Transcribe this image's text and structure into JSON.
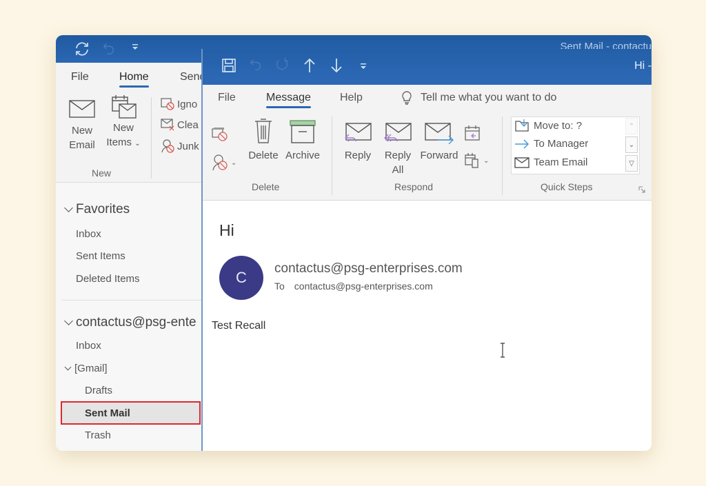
{
  "main_window": {
    "title": "Sent Mail - contactu",
    "quick_access": [
      {
        "icon": "sync-icon"
      },
      {
        "icon": "undo-icon"
      },
      {
        "icon": "customize-qat-icon"
      }
    ],
    "tabs": [
      {
        "label": "File",
        "active": false
      },
      {
        "label": "Home",
        "active": true
      },
      {
        "label": "Send",
        "active": false
      }
    ],
    "ribbon": {
      "new_group": {
        "label": "New",
        "new_email": "New\nEmail",
        "new_email_l1": "New",
        "new_email_l2": "Email",
        "new_items_l1": "New",
        "new_items_l2": "Items"
      },
      "delete_group_partial": [
        "Ignore",
        "Clean Up",
        "Junk"
      ],
      "delete_group_visible": [
        "Igno",
        "Clea",
        "Junk"
      ]
    },
    "nav": {
      "favorites_label": "Favorites",
      "favorites": [
        "Inbox",
        "Sent Items",
        "Deleted Items"
      ],
      "account_label": "contactus@psg-ente",
      "account_items": {
        "inbox": "Inbox",
        "gmail_label": "[Gmail]",
        "gmail_children": [
          "Drafts",
          "Sent Mail",
          "Trash"
        ]
      },
      "selected": "Sent Mail",
      "selection_highlight_color": "#e0262b"
    }
  },
  "message_window": {
    "title": "Hi  -",
    "quick_access": [
      {
        "icon": "save-icon"
      },
      {
        "icon": "undo-icon"
      },
      {
        "icon": "redo-icon"
      },
      {
        "icon": "previous-item-icon"
      },
      {
        "icon": "next-item-icon"
      },
      {
        "icon": "customize-qat-icon"
      }
    ],
    "tabs": [
      {
        "label": "File",
        "active": false
      },
      {
        "label": "Message",
        "active": true
      },
      {
        "label": "Help",
        "active": false
      }
    ],
    "tell_me_placeholder": "Tell me what you want to do",
    "ribbon": {
      "delete_group": {
        "label": "Delete",
        "delete": "Delete",
        "archive": "Archive"
      },
      "respond_group": {
        "label": "Respond",
        "reply": "Reply",
        "reply_all_l1": "Reply",
        "reply_all_l2": "All",
        "forward": "Forward"
      },
      "quick_steps_group": {
        "label": "Quick Steps",
        "items": [
          "Move to: ?",
          "To Manager",
          "Team Email"
        ]
      }
    },
    "reading_pane": {
      "subject": "Hi",
      "avatar_initial": "C",
      "avatar_color": "#3a3a87",
      "sender": "contactus@psg-enterprises.com",
      "to_label": "To",
      "to_address": "contactus@psg-enterprises.com",
      "body": "Test Recall"
    }
  },
  "colors": {
    "titlebar": "#2b67b3",
    "accent": "#2b67b3",
    "page_background": "#fdf6e6"
  }
}
